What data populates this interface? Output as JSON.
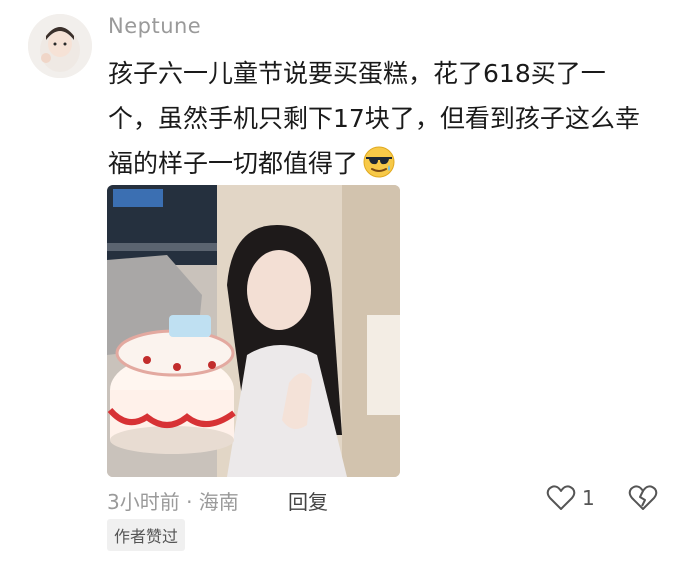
{
  "comment": {
    "username": "Neptune",
    "lines": [
      "孩子六一儿童节说要买蛋糕，花了618买了一",
      "个，虽然手机只剩下17块了，但看到孩子这么幸",
      "福的样子一切都值得了"
    ],
    "emoji": "cool-sunglasses-emoji",
    "meta": "3小时前 · 海南",
    "reply_label": "回复",
    "like_count": "1",
    "badge": "作者赞过"
  },
  "icons": {
    "like": "heart-outline-icon",
    "dislike": "broken-heart-icon"
  },
  "colors": {
    "username": "#9a9a9a",
    "text": "#1a1a1a",
    "meta": "#9a9a9a",
    "badge_bg": "#f0f0f0"
  }
}
